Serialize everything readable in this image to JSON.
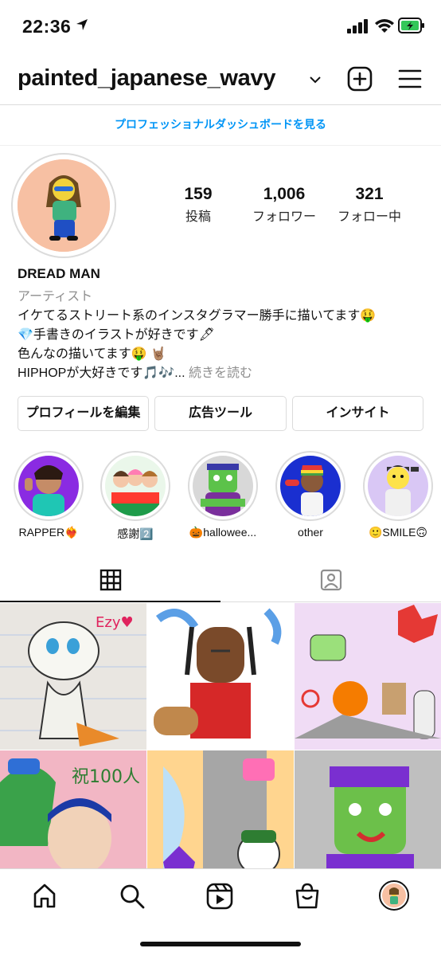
{
  "status_bar": {
    "time": "22:36"
  },
  "header": {
    "username": "painted_japanese_wavy"
  },
  "pro_dashboard_link": "プロフェッショナルダッシュボードを見る",
  "profile": {
    "posts_count": "159",
    "posts_label": "投稿",
    "followers_count": "1,006",
    "followers_label": "フォロワー",
    "following_count": "321",
    "following_label": "フォロー中",
    "display_name": "DREAD MAN",
    "category": "アーティスト",
    "bio": [
      "イケてるストリート系のインスタグラマー勝手に描いてます🤑",
      "💎手書きのイラストが好きです🖋",
      "色んなの描いてます🤑 🤘🏽",
      "HIPHOPが大好きです🎵🎶..."
    ],
    "bio_more": " 続きを読む"
  },
  "buttons": {
    "edit_profile": "プロフィールを編集",
    "ad_tools": "広告ツール",
    "insights": "インサイト"
  },
  "highlights": [
    {
      "label": "RAPPER❤️‍🔥",
      "bg": "#8a2be2"
    },
    {
      "label": "感謝2️⃣",
      "bg": "#eaf7ea"
    },
    {
      "label": "🎃halloweе...",
      "bg": "#d8d8d8"
    },
    {
      "label": "other",
      "bg": "#1a2fd0"
    },
    {
      "label": "🙂SMILE🙃",
      "bg": "#d9c7f5"
    }
  ],
  "tabs": {
    "grid_icon": "grid-icon",
    "tagged_icon": "tagged-person-icon"
  },
  "grid_colors": [
    "#e9e6e1",
    "#ffffff",
    "#f0dcf5",
    "#f2b6c4",
    "#ffd58f",
    "#bfbfbf"
  ],
  "bottom_nav": [
    "home-icon",
    "search-icon",
    "reels-icon",
    "shop-icon",
    "profile-avatar"
  ],
  "colors": {
    "link_blue": "#0095f6",
    "battery_green": "#34c759"
  }
}
